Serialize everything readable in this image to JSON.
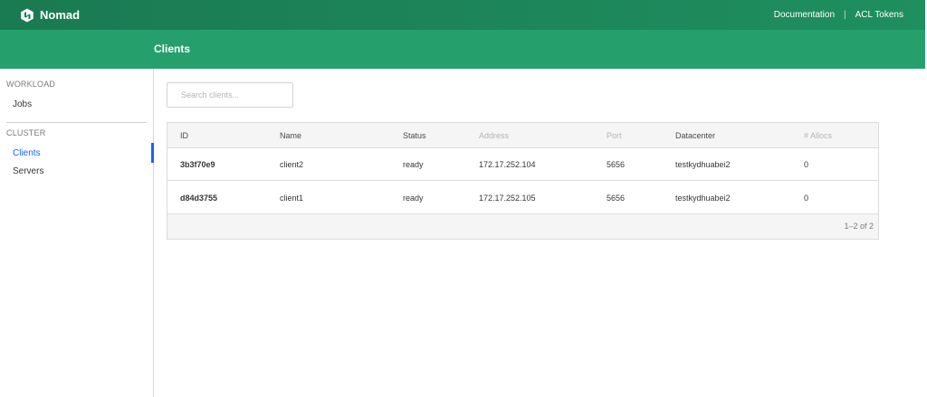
{
  "brand": {
    "name": "Nomad",
    "logo_icon": "nomad-logo-icon"
  },
  "topnav": {
    "documentation": "Documentation",
    "separator": "|",
    "acl_tokens": "ACL Tokens"
  },
  "page_title": "Clients",
  "sidebar": {
    "sections": [
      {
        "label": "WORKLOAD",
        "items": [
          {
            "label": "Jobs",
            "active": false
          }
        ]
      },
      {
        "label": "CLUSTER",
        "items": [
          {
            "label": "Clients",
            "active": true
          },
          {
            "label": "Servers",
            "active": false
          }
        ]
      }
    ]
  },
  "search": {
    "placeholder": "Search clients...",
    "value": ""
  },
  "table": {
    "headers": [
      "ID",
      "Name",
      "Status",
      "Address",
      "Port",
      "Datacenter",
      "# Allocs"
    ],
    "rows": [
      [
        "3b3f70e9",
        "client2",
        "ready",
        "172.17.252.104",
        "5656",
        "testkydhuabei2",
        "0"
      ],
      [
        "d84d3755",
        "client1",
        "ready",
        "172.17.252.105",
        "5656",
        "testkydhuabei2",
        "0"
      ]
    ],
    "pagination": "1–2 of 2"
  },
  "colors": {
    "topbar": "#1a7a52",
    "subnav": "#25a06c",
    "active_link": "#1563ff"
  }
}
